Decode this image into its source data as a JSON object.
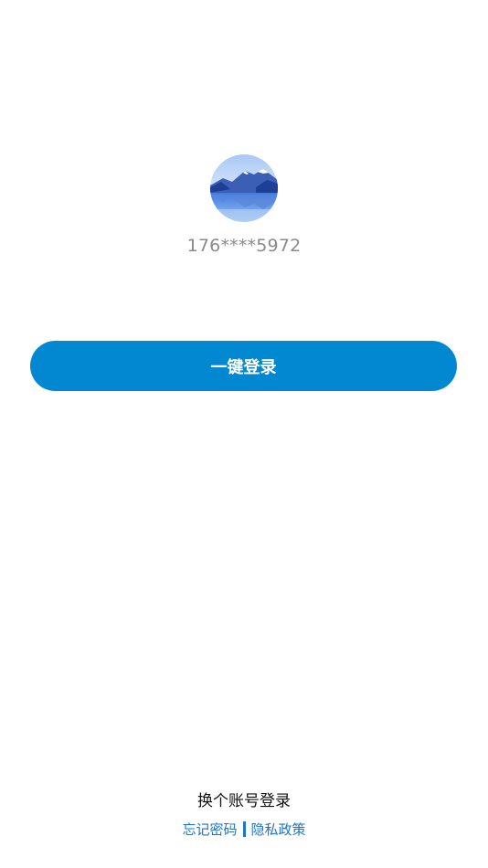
{
  "account": {
    "phone_masked": "176****5972"
  },
  "actions": {
    "login_label": "一键登录",
    "switch_account_label": "换个账号登录",
    "forgot_password_label": "忘记密码",
    "privacy_policy_label": "隐私政策"
  },
  "colors": {
    "primary": "#0288d1",
    "link": "#1976d2",
    "phone_text": "#8a8a8a"
  }
}
